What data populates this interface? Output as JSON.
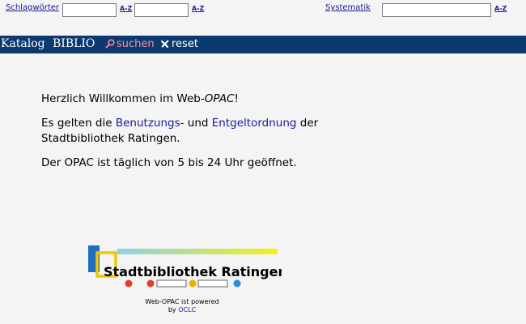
{
  "search": {
    "schlagwoerter_label": "Schlagwörter",
    "systematik_label": "Systematik",
    "az_label": "A-Z",
    "field1_value": "",
    "field2_value": "",
    "field3_value": ""
  },
  "nav": {
    "katalog": "Katalog",
    "biblio": "BIBLIO",
    "suchen": "suchen",
    "reset": "reset"
  },
  "welcome": {
    "line1_pre": "Herzlich Willkommen im Web-",
    "line1_em": "OPAC",
    "line1_post": "!",
    "line2_pre": "Es gelten die ",
    "link_benutzung": "Benutzungs-",
    "line2_mid": " und ",
    "link_entgelt": "Entgeltordnung",
    "line2_post": " der",
    "line3": "Stadtbibliothek Ratingen.",
    "hours": "Der OPAC ist täglich von 5 bis 24 Uhr geöffnet."
  },
  "logo": {
    "name": "Stadtbibliothek Ratingen"
  },
  "footer": {
    "powered": "Web-OPAC ist powered",
    "by": "by ",
    "oclc": "OCLC"
  },
  "colors": {
    "nav_bg": "#0d3a6e",
    "link": "#1a1a9c",
    "suchen": "#ff8fa0"
  }
}
